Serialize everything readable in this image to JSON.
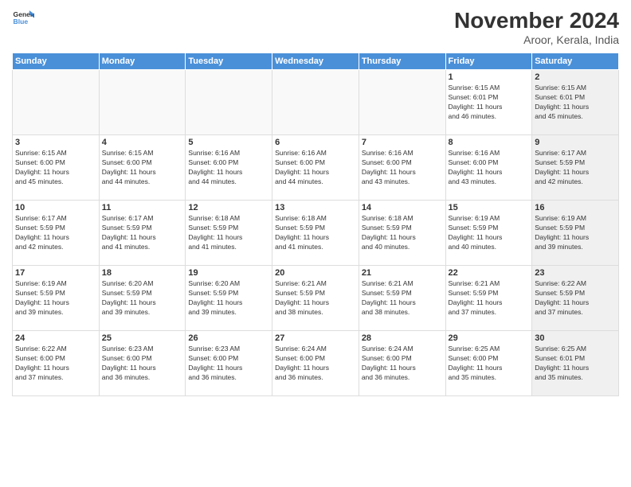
{
  "logo": {
    "line1": "General",
    "line2": "Blue"
  },
  "title": "November 2024",
  "location": "Aroor, Kerala, India",
  "days_header": [
    "Sunday",
    "Monday",
    "Tuesday",
    "Wednesday",
    "Thursday",
    "Friday",
    "Saturday"
  ],
  "weeks": [
    [
      {
        "day": "",
        "info": "",
        "shaded": false,
        "empty": true
      },
      {
        "day": "",
        "info": "",
        "shaded": false,
        "empty": true
      },
      {
        "day": "",
        "info": "",
        "shaded": false,
        "empty": true
      },
      {
        "day": "",
        "info": "",
        "shaded": false,
        "empty": true
      },
      {
        "day": "",
        "info": "",
        "shaded": false,
        "empty": true
      },
      {
        "day": "1",
        "info": "Sunrise: 6:15 AM\nSunset: 6:01 PM\nDaylight: 11 hours\nand 46 minutes.",
        "shaded": false,
        "empty": false
      },
      {
        "day": "2",
        "info": "Sunrise: 6:15 AM\nSunset: 6:01 PM\nDaylight: 11 hours\nand 45 minutes.",
        "shaded": true,
        "empty": false
      }
    ],
    [
      {
        "day": "3",
        "info": "Sunrise: 6:15 AM\nSunset: 6:00 PM\nDaylight: 11 hours\nand 45 minutes.",
        "shaded": false,
        "empty": false
      },
      {
        "day": "4",
        "info": "Sunrise: 6:15 AM\nSunset: 6:00 PM\nDaylight: 11 hours\nand 44 minutes.",
        "shaded": false,
        "empty": false
      },
      {
        "day": "5",
        "info": "Sunrise: 6:16 AM\nSunset: 6:00 PM\nDaylight: 11 hours\nand 44 minutes.",
        "shaded": false,
        "empty": false
      },
      {
        "day": "6",
        "info": "Sunrise: 6:16 AM\nSunset: 6:00 PM\nDaylight: 11 hours\nand 44 minutes.",
        "shaded": false,
        "empty": false
      },
      {
        "day": "7",
        "info": "Sunrise: 6:16 AM\nSunset: 6:00 PM\nDaylight: 11 hours\nand 43 minutes.",
        "shaded": false,
        "empty": false
      },
      {
        "day": "8",
        "info": "Sunrise: 6:16 AM\nSunset: 6:00 PM\nDaylight: 11 hours\nand 43 minutes.",
        "shaded": false,
        "empty": false
      },
      {
        "day": "9",
        "info": "Sunrise: 6:17 AM\nSunset: 5:59 PM\nDaylight: 11 hours\nand 42 minutes.",
        "shaded": true,
        "empty": false
      }
    ],
    [
      {
        "day": "10",
        "info": "Sunrise: 6:17 AM\nSunset: 5:59 PM\nDaylight: 11 hours\nand 42 minutes.",
        "shaded": false,
        "empty": false
      },
      {
        "day": "11",
        "info": "Sunrise: 6:17 AM\nSunset: 5:59 PM\nDaylight: 11 hours\nand 41 minutes.",
        "shaded": false,
        "empty": false
      },
      {
        "day": "12",
        "info": "Sunrise: 6:18 AM\nSunset: 5:59 PM\nDaylight: 11 hours\nand 41 minutes.",
        "shaded": false,
        "empty": false
      },
      {
        "day": "13",
        "info": "Sunrise: 6:18 AM\nSunset: 5:59 PM\nDaylight: 11 hours\nand 41 minutes.",
        "shaded": false,
        "empty": false
      },
      {
        "day": "14",
        "info": "Sunrise: 6:18 AM\nSunset: 5:59 PM\nDaylight: 11 hours\nand 40 minutes.",
        "shaded": false,
        "empty": false
      },
      {
        "day": "15",
        "info": "Sunrise: 6:19 AM\nSunset: 5:59 PM\nDaylight: 11 hours\nand 40 minutes.",
        "shaded": false,
        "empty": false
      },
      {
        "day": "16",
        "info": "Sunrise: 6:19 AM\nSunset: 5:59 PM\nDaylight: 11 hours\nand 39 minutes.",
        "shaded": true,
        "empty": false
      }
    ],
    [
      {
        "day": "17",
        "info": "Sunrise: 6:19 AM\nSunset: 5:59 PM\nDaylight: 11 hours\nand 39 minutes.",
        "shaded": false,
        "empty": false
      },
      {
        "day": "18",
        "info": "Sunrise: 6:20 AM\nSunset: 5:59 PM\nDaylight: 11 hours\nand 39 minutes.",
        "shaded": false,
        "empty": false
      },
      {
        "day": "19",
        "info": "Sunrise: 6:20 AM\nSunset: 5:59 PM\nDaylight: 11 hours\nand 39 minutes.",
        "shaded": false,
        "empty": false
      },
      {
        "day": "20",
        "info": "Sunrise: 6:21 AM\nSunset: 5:59 PM\nDaylight: 11 hours\nand 38 minutes.",
        "shaded": false,
        "empty": false
      },
      {
        "day": "21",
        "info": "Sunrise: 6:21 AM\nSunset: 5:59 PM\nDaylight: 11 hours\nand 38 minutes.",
        "shaded": false,
        "empty": false
      },
      {
        "day": "22",
        "info": "Sunrise: 6:21 AM\nSunset: 5:59 PM\nDaylight: 11 hours\nand 37 minutes.",
        "shaded": false,
        "empty": false
      },
      {
        "day": "23",
        "info": "Sunrise: 6:22 AM\nSunset: 5:59 PM\nDaylight: 11 hours\nand 37 minutes.",
        "shaded": true,
        "empty": false
      }
    ],
    [
      {
        "day": "24",
        "info": "Sunrise: 6:22 AM\nSunset: 6:00 PM\nDaylight: 11 hours\nand 37 minutes.",
        "shaded": false,
        "empty": false
      },
      {
        "day": "25",
        "info": "Sunrise: 6:23 AM\nSunset: 6:00 PM\nDaylight: 11 hours\nand 36 minutes.",
        "shaded": false,
        "empty": false
      },
      {
        "day": "26",
        "info": "Sunrise: 6:23 AM\nSunset: 6:00 PM\nDaylight: 11 hours\nand 36 minutes.",
        "shaded": false,
        "empty": false
      },
      {
        "day": "27",
        "info": "Sunrise: 6:24 AM\nSunset: 6:00 PM\nDaylight: 11 hours\nand 36 minutes.",
        "shaded": false,
        "empty": false
      },
      {
        "day": "28",
        "info": "Sunrise: 6:24 AM\nSunset: 6:00 PM\nDaylight: 11 hours\nand 36 minutes.",
        "shaded": false,
        "empty": false
      },
      {
        "day": "29",
        "info": "Sunrise: 6:25 AM\nSunset: 6:00 PM\nDaylight: 11 hours\nand 35 minutes.",
        "shaded": false,
        "empty": false
      },
      {
        "day": "30",
        "info": "Sunrise: 6:25 AM\nSunset: 6:01 PM\nDaylight: 11 hours\nand 35 minutes.",
        "shaded": true,
        "empty": false
      }
    ]
  ]
}
